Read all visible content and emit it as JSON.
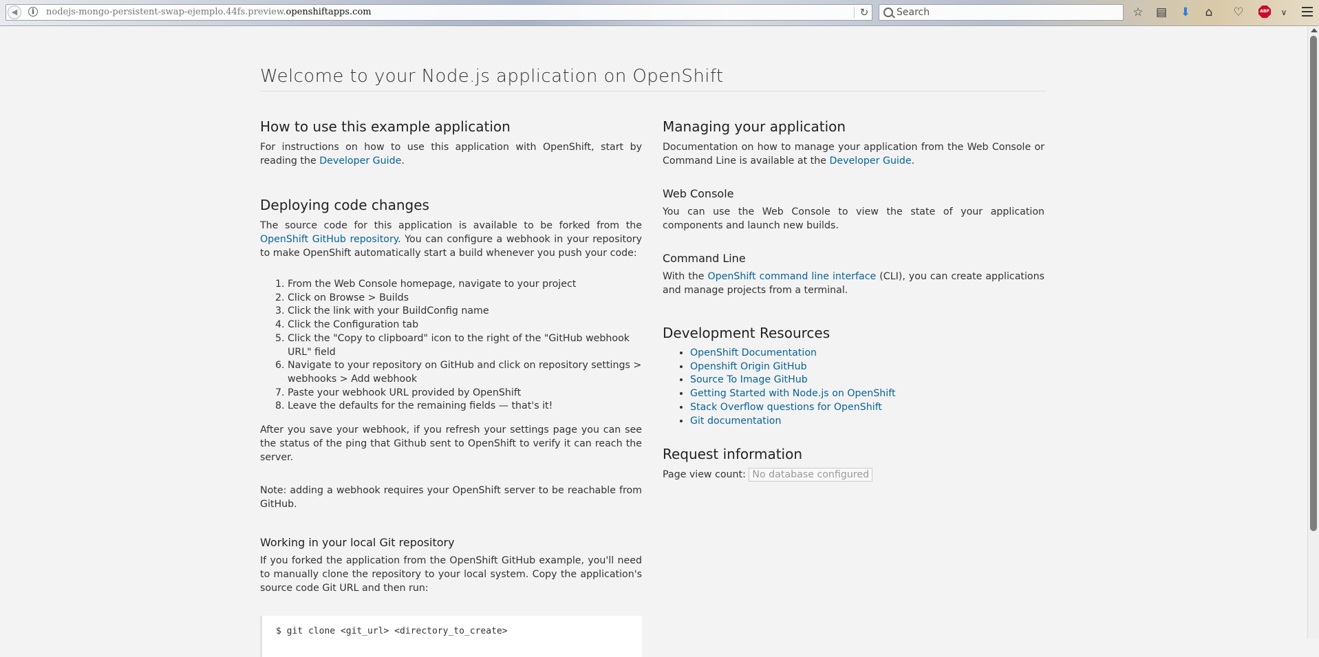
{
  "browser": {
    "url_path": "nodejs-mongo-persistent-swap-ejemplo.44fs.preview.",
    "url_host": "openshiftapps.com",
    "search_placeholder": "Search",
    "abp_label": "ABP"
  },
  "page": {
    "title": "Welcome to your Node.js application on OpenShift"
  },
  "left": {
    "howto": {
      "heading": "How to use this example application",
      "text_before": "For instructions on how to use this application with OpenShift, start by reading the ",
      "link": "Developer Guide",
      "text_after": "."
    },
    "deploy": {
      "heading": "Deploying code changes",
      "text_before": "The source code for this application is available to be forked from the ",
      "link": "OpenShift GitHub repository",
      "text_after": ". You can configure a webhook in your repository to make OpenShift automatically start a build whenever you push your code:",
      "steps": [
        "From the Web Console homepage, navigate to your project",
        "Click on Browse > Builds",
        "Click the link with your BuildConfig name",
        "Click the Configuration tab",
        "Click the \"Copy to clipboard\" icon to the right of the \"GitHub webhook URL\" field",
        "Navigate to your repository on GitHub and click on repository settings > webhooks > Add webhook",
        "Paste your webhook URL provided by OpenShift",
        "Leave the defaults for the remaining fields — that's it!"
      ],
      "after_save": "After you save your webhook, if you refresh your settings page you can see the status of the ping that Github sent to OpenShift to verify it can reach the server.",
      "note": "Note: adding a webhook requires your OpenShift server to be reachable from GitHub."
    },
    "local": {
      "heading": "Working in your local Git repository",
      "text": "If you forked the application from the OpenShift GitHub example, you'll need to manually clone the repository to your local system. Copy the application's source code Git URL and then run:",
      "code": "$ git clone <git_url> <directory_to_create>"
    }
  },
  "right": {
    "managing": {
      "heading": "Managing your application",
      "text_before": "Documentation on how to manage your application from the Web Console or Command Line is available at the ",
      "link": "Developer Guide",
      "text_after": "."
    },
    "webconsole": {
      "heading": "Web Console",
      "text": "You can use the Web Console to view the state of your application components and launch new builds."
    },
    "cmdline": {
      "heading": "Command Line",
      "text_before": "With the ",
      "link": "OpenShift command line interface",
      "text_after": " (CLI), you can create applications and manage projects from a terminal."
    },
    "devres": {
      "heading": "Development Resources",
      "links": [
        "OpenShift Documentation",
        "Openshift Origin GitHub",
        "Source To Image GitHub",
        "Getting Started with Node.js on OpenShift",
        "Stack Overflow questions for OpenShift",
        "Git documentation"
      ]
    },
    "request": {
      "heading": "Request information",
      "count_label": "Page view count:",
      "count_value": "No database configured"
    }
  }
}
